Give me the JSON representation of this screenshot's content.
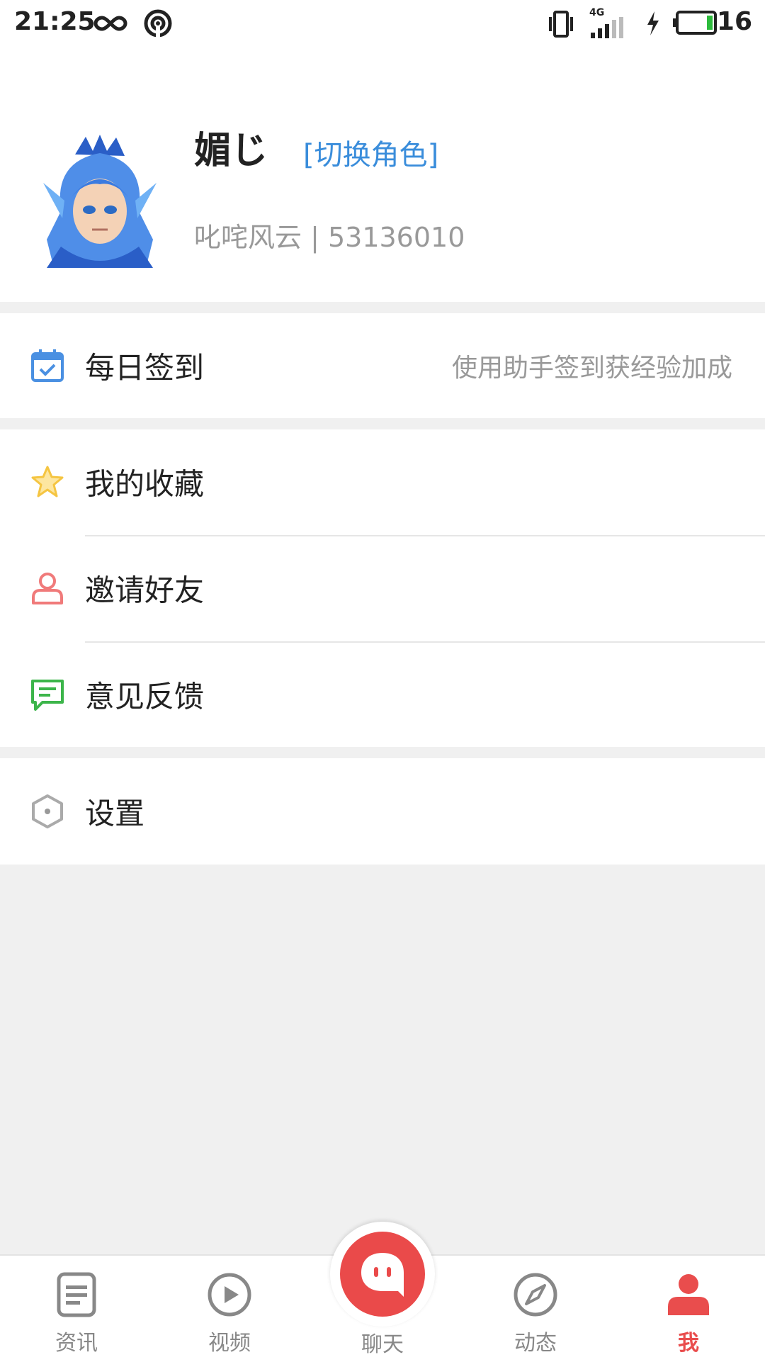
{
  "status_bar": {
    "time": "21:25",
    "network": "4G",
    "battery_level": "16",
    "icons": [
      "infinity-icon",
      "hotspot-icon",
      "vibrate-icon",
      "signal-icon",
      "charging-icon",
      "battery-icon"
    ]
  },
  "profile": {
    "name": "媚じ",
    "switch_role": "[切换角色]",
    "server_info": "叱咤风云 | 53136010",
    "avatar_icon": "avatar"
  },
  "menu": {
    "checkin": {
      "label": "每日签到",
      "hint": "使用助手签到获经验加成",
      "icon": "calendar-check-icon"
    },
    "favorites": {
      "label": "我的收藏",
      "icon": "star-icon"
    },
    "invite": {
      "label": "邀请好友",
      "icon": "user-icon"
    },
    "feedback": {
      "label": "意见反馈",
      "icon": "chat-message-icon"
    },
    "settings": {
      "label": "设置",
      "icon": "hexagon-settings-icon"
    }
  },
  "tabs": [
    {
      "label": "资讯",
      "icon": "document-icon",
      "active": false
    },
    {
      "label": "视频",
      "icon": "play-circle-icon",
      "active": false
    },
    {
      "label": "聊天",
      "icon": "chat-bubble-icon",
      "active": false
    },
    {
      "label": "动态",
      "icon": "compass-icon",
      "active": false
    },
    {
      "label": "我",
      "icon": "person-icon",
      "active": true
    }
  ],
  "colors": {
    "accent_red": "#e94d4d",
    "link_blue": "#3a8ddb",
    "calendar_blue": "#4a90e2",
    "star_yellow": "#f5c542",
    "user_red": "#f07a7a",
    "feedback_green": "#3cb54a",
    "background_gray": "#f0f0f0"
  }
}
